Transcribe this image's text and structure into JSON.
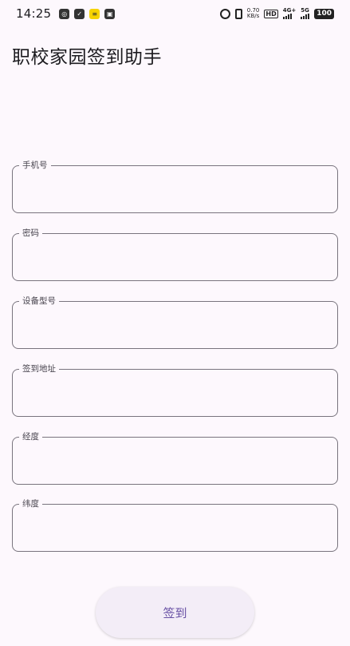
{
  "status_bar": {
    "time": "14:25",
    "net_speed_value": "0.70",
    "net_speed_unit": "KB/s",
    "hd_label": "HD",
    "network_4g": "4G+",
    "network_5g": "5G",
    "battery": "100",
    "notification_icons": [
      "chat-icon",
      "shield-icon",
      "news-icon",
      "app-icon"
    ]
  },
  "header": {
    "title": "职校家园签到助手"
  },
  "form": {
    "phone_label": "手机号",
    "password_label": "密码",
    "device_label": "设备型号",
    "address_label": "签到地址",
    "longitude_label": "经度",
    "latitude_label": "纬度"
  },
  "actions": {
    "sign_in_label": "签到"
  },
  "colors": {
    "background": "#fdf8fd",
    "outline": "#79747e",
    "button_bg": "#f3edf7",
    "accent": "#6750a4"
  }
}
